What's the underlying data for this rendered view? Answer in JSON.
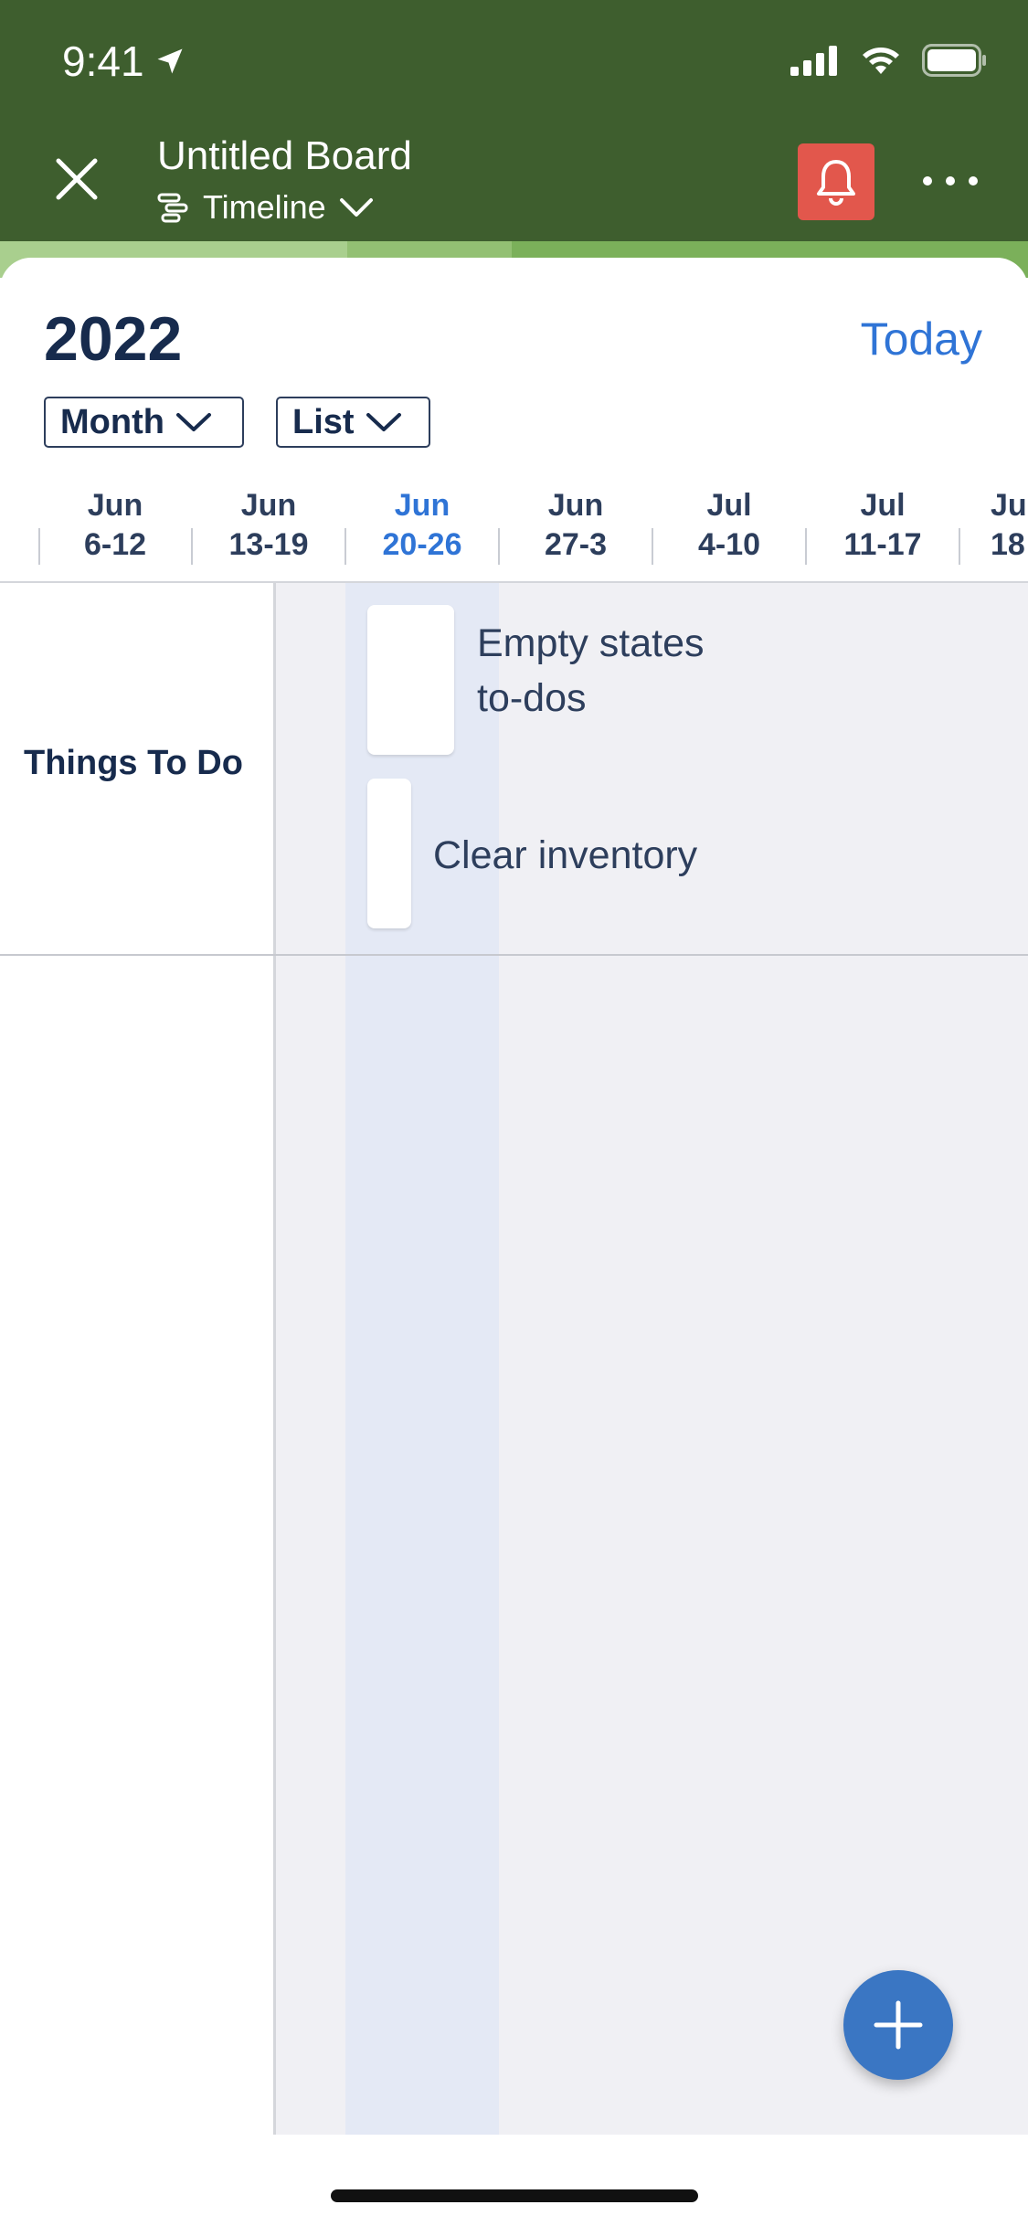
{
  "status_bar": {
    "time": "9:41"
  },
  "header": {
    "title": "Untitled Board",
    "view_label": "Timeline"
  },
  "toolbar": {
    "year": "2022",
    "today_label": "Today",
    "scale_dropdown": "Month",
    "group_dropdown": "List"
  },
  "weeks": [
    {
      "month": "Jun",
      "range": "6-12"
    },
    {
      "month": "Jun",
      "range": "13-19"
    },
    {
      "month": "Jun",
      "range": "20-26",
      "current": true
    },
    {
      "month": "Jun",
      "range": "27-3"
    },
    {
      "month": "Jul",
      "range": "4-10"
    },
    {
      "month": "Jul",
      "range": "11-17"
    },
    {
      "month": "Jul",
      "range": "18"
    }
  ],
  "lane": {
    "title": "Things To Do"
  },
  "cards": [
    {
      "line1": "Empty states",
      "line2": "to-dos"
    },
    {
      "line1": "Clear inventory"
    }
  ],
  "colors": {
    "header_bg": "#3e5e2e",
    "accent_blue": "#2f74d6",
    "bell_red": "#e2574c",
    "fab_blue": "#3a76c3"
  },
  "icons": [
    "location-arrow-icon",
    "signal-icon",
    "wifi-icon",
    "battery-icon",
    "close-icon",
    "timeline-icon",
    "chevron-down-icon",
    "bell-icon",
    "more-icon",
    "plus-icon"
  ]
}
